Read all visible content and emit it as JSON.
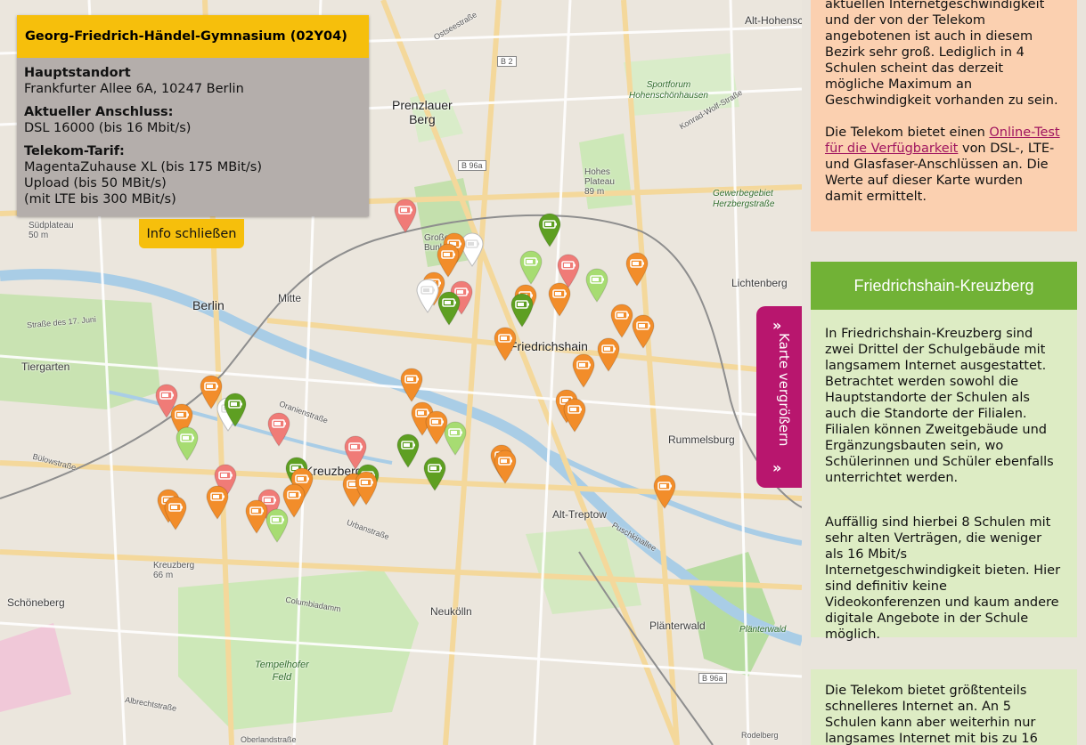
{
  "map": {
    "places": [
      {
        "name": "Prenzlauer\nBerg",
        "cls": "big"
      },
      {
        "name": "Berlin",
        "cls": "big"
      },
      {
        "name": "Mitte",
        "cls": "big"
      },
      {
        "name": "Tiergarten",
        "cls": ""
      },
      {
        "name": "Friedrichshain",
        "cls": "big"
      },
      {
        "name": "Lichtenberg",
        "cls": ""
      },
      {
        "name": "Rummelsburg",
        "cls": ""
      },
      {
        "name": "Alt-Treptow",
        "cls": ""
      },
      {
        "name": "Kreuzberg",
        "cls": "big"
      },
      {
        "name": "Schöneberg",
        "cls": ""
      },
      {
        "name": "Neukölln",
        "cls": ""
      },
      {
        "name": "Plänterwald",
        "cls": ""
      },
      {
        "name": "Tempelhofer\nFeld",
        "cls": "park"
      },
      {
        "name": "Alt-Hohensch",
        "cls": ""
      },
      {
        "name": "Großer\nBunkerb",
        "cls": ""
      },
      {
        "name": "Hohes\nPlateau\n89 m",
        "cls": ""
      },
      {
        "name": "Südplateau\n50 m",
        "cls": ""
      },
      {
        "name": "Kreuzberg\n66 m",
        "cls": ""
      },
      {
        "name": "Sportforum\nHohenschönhausen",
        "cls": "park"
      },
      {
        "name": "Gewerbegebiet\nHerzbergstraße",
        "cls": "park"
      },
      {
        "name": "Ostseestraße",
        "cls": "road"
      },
      {
        "name": "Konrad-Wolf-Straße",
        "cls": "road"
      },
      {
        "name": "Oranienstraße",
        "cls": "road"
      },
      {
        "name": "Urbanstraße",
        "cls": "road"
      },
      {
        "name": "Columbiadamm",
        "cls": "road"
      },
      {
        "name": "Straße des 17. Juni",
        "cls": "road"
      },
      {
        "name": "Bülowstraße",
        "cls": "road"
      },
      {
        "name": "Puschkinallee",
        "cls": "road"
      },
      {
        "name": "Albrechtstraße",
        "cls": "road"
      },
      {
        "name": "Oberlandstraße",
        "cls": "road"
      },
      {
        "name": "B 2",
        "cls": "road"
      },
      {
        "name": "B 96a",
        "cls": "road"
      },
      {
        "name": "B 96a",
        "cls": "road"
      },
      {
        "name": "Rodelberg",
        "cls": "road"
      },
      {
        "name": "Plänterwald",
        "cls": "park"
      }
    ],
    "marker_colors": {
      "orange": "#f28d2a",
      "red": "#f07b77",
      "lightgreen": "#a7dc72",
      "green": "#5e9f22",
      "white": "#ffffff"
    }
  },
  "info": {
    "title": "Georg-Friedrich-Händel-Gymnasium (02Y04)",
    "main_label": "Hauptstandort",
    "address": "Frankfurter Allee 6A, 10247 Berlin",
    "connection_label": "Aktueller Anschluss:",
    "connection_value": "DSL 16000 (bis 16 Mbit/s)",
    "tariff_label": "Telekom-Tarif:",
    "tariff_line1": "MagentaZuhause XL (bis 175 MBit/s)",
    "tariff_line2": "Upload (bis 50 MBit/s)",
    "tariff_line3": "(mit LTE bis 300 MBit/s)",
    "close_label": "Info schließen"
  },
  "enlarge": {
    "label": "Karte vergrößern",
    "chevron": "»"
  },
  "side": {
    "card1_p1": "aktuellen Internetgeschwindigkeit und der von der Telekom angebotenen ist auch in diesem Bezirk sehr groß. Lediglich in 4 Schulen scheint das derzeit mögliche Maximum an Geschwindigkeit vorhanden zu sein.",
    "card1_p2_pre": "Die Telekom bietet einen ",
    "card1_link": "Online-Test für die Verfügbarkeit",
    "card1_p2_post": " von DSL-, LTE- und Glasfaser-Anschlüssen an. Die Werte auf dieser Karte wurden damit ermittelt.",
    "card2_title": "Friedrichshain-Kreuzberg",
    "card2_p1": "In Friedrichshain-Kreuzberg sind zwei Drittel der Schulgebäude mit langsamem Internet ausgestattet. Betrachtet werden sowohl die Hauptstandorte der Schulen als auch die Standorte der Filialen. Filialen können Zweitgebäude und Ergänzungsbauten sein, wo Schülerinnen und Schüler ebenfalls unterrichtet werden.",
    "card2_p2": "Auffällig sind hierbei 8 Schulen mit sehr alten Verträgen, die weniger als 16 Mbit/s Internetgeschwindigkeit bieten. Hier sind definitiv keine Videokonferenzen und kaum andere digitale Angebote in der Schule möglich.",
    "card3_p1": "Die Telekom bietet größtenteils schnelleres Internet an. An 5 Schulen kann aber weiterhin nur langsames Internet mit bis zu 16"
  }
}
